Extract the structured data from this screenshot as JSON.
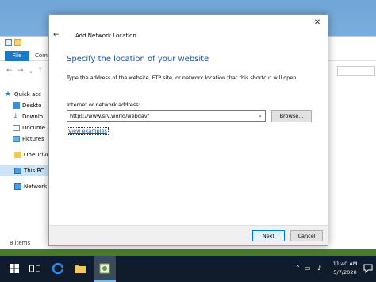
{
  "explorer": {
    "tab_file": "File",
    "tab_computer": "Compu",
    "sidebar": [
      {
        "label": "Quick acc",
        "icon": "star-icon"
      },
      {
        "label": "Deskto",
        "icon": "desktop-icon"
      },
      {
        "label": "Downlo",
        "icon": "download-icon"
      },
      {
        "label": "Docume",
        "icon": "document-icon"
      },
      {
        "label": "Pictures",
        "icon": "picture-icon"
      },
      {
        "label": "OneDrive",
        "icon": "folder-icon"
      },
      {
        "label": "This PC",
        "icon": "pc-icon"
      },
      {
        "label": "Network",
        "icon": "network-icon"
      }
    ],
    "status": "8 items"
  },
  "dialog": {
    "title": "Add Network Location",
    "heading": "Specify the location of your website",
    "description": "Type the address of the website, FTP site, or network location that this shortcut will open.",
    "field_label": "Internet or network address:",
    "address_value": "https://www.srv.world/webdav/",
    "browse_label": "Browse...",
    "view_examples": "View examples",
    "next_label": "Next",
    "cancel_label": "Cancel"
  },
  "taskbar": {
    "time": "11:40 AM",
    "date": "5/7/2020"
  },
  "colors": {
    "accent": "#1979ca",
    "heading": "#1a56a8",
    "taskbar": "#101c2c"
  }
}
